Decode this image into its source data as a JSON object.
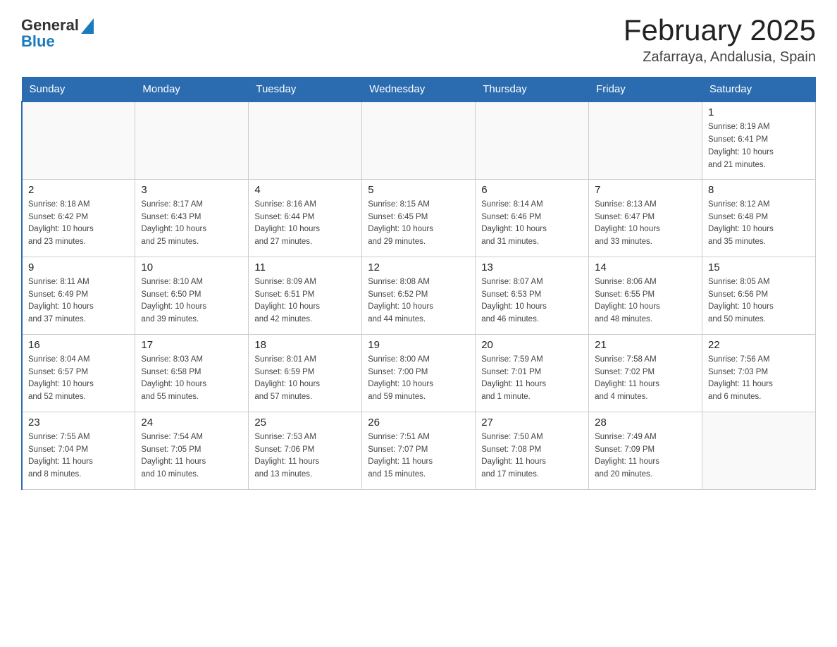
{
  "logo": {
    "general": "General",
    "blue": "Blue",
    "arrow": "▲"
  },
  "title": "February 2025",
  "subtitle": "Zafarraya, Andalusia, Spain",
  "days_of_week": [
    "Sunday",
    "Monday",
    "Tuesday",
    "Wednesday",
    "Thursday",
    "Friday",
    "Saturday"
  ],
  "weeks": [
    {
      "days": [
        {
          "num": "",
          "info": ""
        },
        {
          "num": "",
          "info": ""
        },
        {
          "num": "",
          "info": ""
        },
        {
          "num": "",
          "info": ""
        },
        {
          "num": "",
          "info": ""
        },
        {
          "num": "",
          "info": ""
        },
        {
          "num": "1",
          "info": "Sunrise: 8:19 AM\nSunset: 6:41 PM\nDaylight: 10 hours\nand 21 minutes."
        }
      ]
    },
    {
      "days": [
        {
          "num": "2",
          "info": "Sunrise: 8:18 AM\nSunset: 6:42 PM\nDaylight: 10 hours\nand 23 minutes."
        },
        {
          "num": "3",
          "info": "Sunrise: 8:17 AM\nSunset: 6:43 PM\nDaylight: 10 hours\nand 25 minutes."
        },
        {
          "num": "4",
          "info": "Sunrise: 8:16 AM\nSunset: 6:44 PM\nDaylight: 10 hours\nand 27 minutes."
        },
        {
          "num": "5",
          "info": "Sunrise: 8:15 AM\nSunset: 6:45 PM\nDaylight: 10 hours\nand 29 minutes."
        },
        {
          "num": "6",
          "info": "Sunrise: 8:14 AM\nSunset: 6:46 PM\nDaylight: 10 hours\nand 31 minutes."
        },
        {
          "num": "7",
          "info": "Sunrise: 8:13 AM\nSunset: 6:47 PM\nDaylight: 10 hours\nand 33 minutes."
        },
        {
          "num": "8",
          "info": "Sunrise: 8:12 AM\nSunset: 6:48 PM\nDaylight: 10 hours\nand 35 minutes."
        }
      ]
    },
    {
      "days": [
        {
          "num": "9",
          "info": "Sunrise: 8:11 AM\nSunset: 6:49 PM\nDaylight: 10 hours\nand 37 minutes."
        },
        {
          "num": "10",
          "info": "Sunrise: 8:10 AM\nSunset: 6:50 PM\nDaylight: 10 hours\nand 39 minutes."
        },
        {
          "num": "11",
          "info": "Sunrise: 8:09 AM\nSunset: 6:51 PM\nDaylight: 10 hours\nand 42 minutes."
        },
        {
          "num": "12",
          "info": "Sunrise: 8:08 AM\nSunset: 6:52 PM\nDaylight: 10 hours\nand 44 minutes."
        },
        {
          "num": "13",
          "info": "Sunrise: 8:07 AM\nSunset: 6:53 PM\nDaylight: 10 hours\nand 46 minutes."
        },
        {
          "num": "14",
          "info": "Sunrise: 8:06 AM\nSunset: 6:55 PM\nDaylight: 10 hours\nand 48 minutes."
        },
        {
          "num": "15",
          "info": "Sunrise: 8:05 AM\nSunset: 6:56 PM\nDaylight: 10 hours\nand 50 minutes."
        }
      ]
    },
    {
      "days": [
        {
          "num": "16",
          "info": "Sunrise: 8:04 AM\nSunset: 6:57 PM\nDaylight: 10 hours\nand 52 minutes."
        },
        {
          "num": "17",
          "info": "Sunrise: 8:03 AM\nSunset: 6:58 PM\nDaylight: 10 hours\nand 55 minutes."
        },
        {
          "num": "18",
          "info": "Sunrise: 8:01 AM\nSunset: 6:59 PM\nDaylight: 10 hours\nand 57 minutes."
        },
        {
          "num": "19",
          "info": "Sunrise: 8:00 AM\nSunset: 7:00 PM\nDaylight: 10 hours\nand 59 minutes."
        },
        {
          "num": "20",
          "info": "Sunrise: 7:59 AM\nSunset: 7:01 PM\nDaylight: 11 hours\nand 1 minute."
        },
        {
          "num": "21",
          "info": "Sunrise: 7:58 AM\nSunset: 7:02 PM\nDaylight: 11 hours\nand 4 minutes."
        },
        {
          "num": "22",
          "info": "Sunrise: 7:56 AM\nSunset: 7:03 PM\nDaylight: 11 hours\nand 6 minutes."
        }
      ]
    },
    {
      "days": [
        {
          "num": "23",
          "info": "Sunrise: 7:55 AM\nSunset: 7:04 PM\nDaylight: 11 hours\nand 8 minutes."
        },
        {
          "num": "24",
          "info": "Sunrise: 7:54 AM\nSunset: 7:05 PM\nDaylight: 11 hours\nand 10 minutes."
        },
        {
          "num": "25",
          "info": "Sunrise: 7:53 AM\nSunset: 7:06 PM\nDaylight: 11 hours\nand 13 minutes."
        },
        {
          "num": "26",
          "info": "Sunrise: 7:51 AM\nSunset: 7:07 PM\nDaylight: 11 hours\nand 15 minutes."
        },
        {
          "num": "27",
          "info": "Sunrise: 7:50 AM\nSunset: 7:08 PM\nDaylight: 11 hours\nand 17 minutes."
        },
        {
          "num": "28",
          "info": "Sunrise: 7:49 AM\nSunset: 7:09 PM\nDaylight: 11 hours\nand 20 minutes."
        },
        {
          "num": "",
          "info": ""
        }
      ]
    }
  ]
}
